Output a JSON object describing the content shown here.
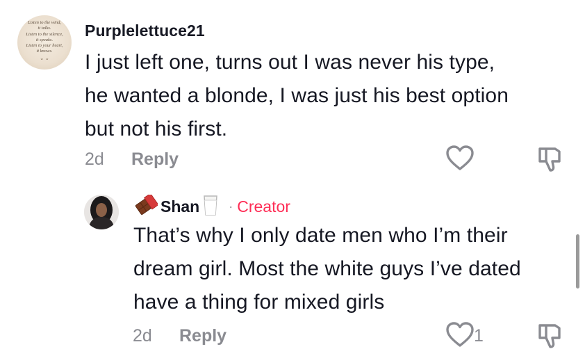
{
  "comment": {
    "avatar_quote_lines": [
      "Listen to the wind,",
      "it talks.",
      "Listen to the silence,",
      "it speaks.",
      "Listen to your heart,",
      "it knows."
    ],
    "username": "Purplelettuce21",
    "text_lines": [
      "I just left one, turns out I was never his type,",
      "he wanted a blonde, I was just his best option",
      "but not his first."
    ],
    "time": "2d",
    "reply_label": "Reply"
  },
  "reply": {
    "username": "Shan",
    "name_emoji_before": "chocolate-bar-icon",
    "name_emoji_after": "milk-glass-icon",
    "separator": "·",
    "creator_label": "Creator",
    "text_lines": [
      "That’s why I only date men who I’m their",
      "dream girl. Most the white guys I’ve dated",
      "have a thing for mixed girls"
    ],
    "time": "2d",
    "reply_label": "Reply",
    "like_count": "1"
  },
  "colors": {
    "text": "#161823",
    "meta": "#8a8b91",
    "creator": "#fe2c55",
    "icon_stroke": "#8a8b91"
  }
}
